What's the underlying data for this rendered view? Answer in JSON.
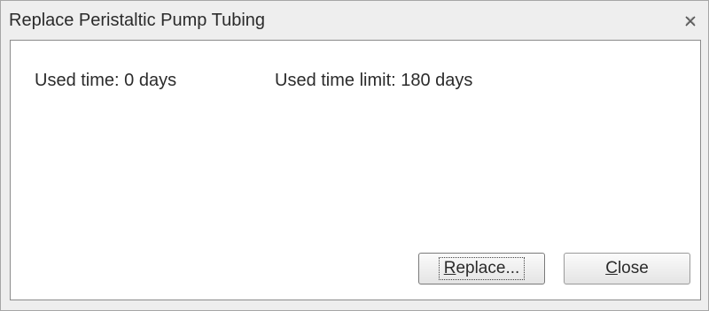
{
  "dialog": {
    "title": "Replace Peristaltic Pump Tubing"
  },
  "info": {
    "used_time": "Used time: 0 days",
    "used_time_limit": "Used time limit: 180 days"
  },
  "buttons": {
    "replace_mnemonic": "R",
    "replace_rest": "eplace...",
    "close_mnemonic": "C",
    "close_rest": "lose"
  },
  "icons": {
    "close": "close-icon"
  }
}
